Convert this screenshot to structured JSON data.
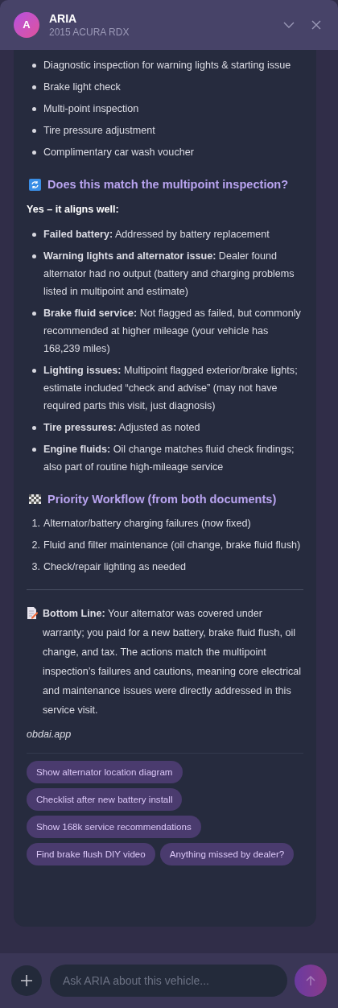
{
  "header": {
    "avatar": "A",
    "title": "ARIA",
    "subtitle": "2015 ACURA RDX"
  },
  "services": [
    "Diagnostic inspection for warning lights & starting issue",
    "Brake light check",
    "Multi-point inspection",
    "Tire pressure adjustment",
    "Complimentary car wash voucher"
  ],
  "match_section": {
    "heading": "Does this match the multipoint inspection?",
    "lead": "Yes – it aligns well:",
    "items": [
      "**Failed battery:** Addressed by battery replacement",
      "**Warning lights and alternator issue:** Dealer found alternator had no output (battery and charging problems listed in multipoint and estimate)",
      "**Brake fluid service:** Not flagged as failed, but commonly recommended at higher mileage (your vehicle has 168,239 miles)",
      "**Lighting issues:** Multipoint flagged exterior/brake lights; estimate included “check and advise” (may not have required parts this visit, just diagnosis)",
      "**Tire pressures:** Adjusted as noted",
      "**Engine fluids:** Oil change matches fluid check findings; also part of routine high-mileage service"
    ]
  },
  "workflow_section": {
    "heading": "Priority Workflow (from both documents)",
    "items": [
      {
        "number": "1.",
        "text": "Alternator/battery charging failures (now fixed)"
      },
      {
        "number": "2.",
        "text": "Fluid and filter maintenance (oil change, brake fluid flush)"
      },
      {
        "number": "3.",
        "text": "Check/repair lighting as needed"
      }
    ]
  },
  "bottom_line": "**Bottom Line:** Your alternator was covered under warranty; you paid for a new battery, brake fluid flush, oil change, and tax. The actions match the multipoint inspection’s failures and cautions, meaning core electrical and maintenance issues were directly addressed in this service visit.",
  "source": "obdai.app",
  "suggestions": [
    "Show alternator location diagram",
    "Checklist after new battery install",
    "Show 168k service recommendations",
    "Find brake flush DIY video",
    "Anything missed by dealer?"
  ],
  "composer": {
    "placeholder": "Ask ARIA about this vehicle..."
  }
}
